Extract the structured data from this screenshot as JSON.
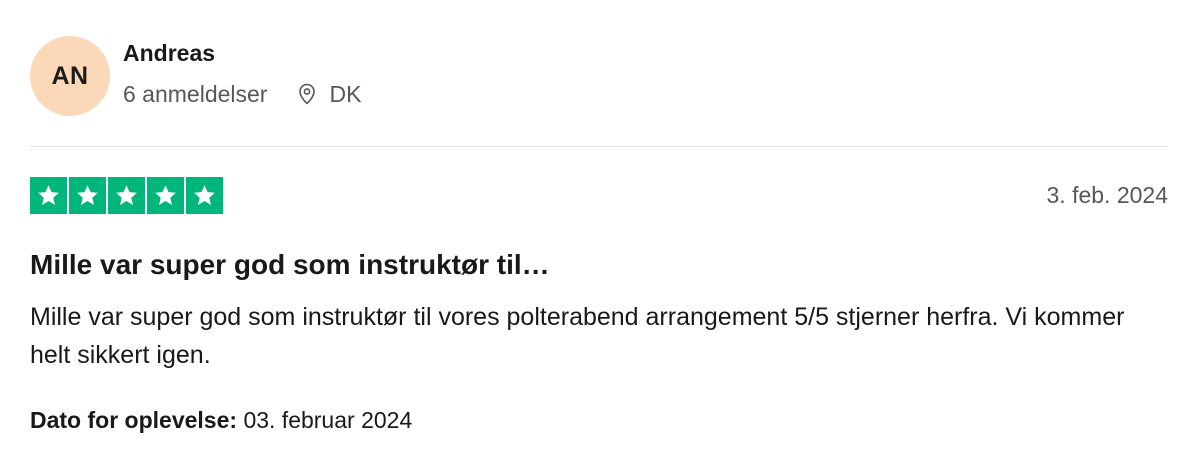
{
  "consumer": {
    "initials": "AN",
    "name": "Andreas",
    "reviews_count": "6 anmeldelser",
    "country": "DK",
    "location_icon": "location-pin-icon",
    "avatar_color": "#fbd9b8"
  },
  "review": {
    "rating": 5,
    "max_rating": 5,
    "star_color": "#00b67a",
    "date": "3. feb. 2024",
    "title": "Mille var super god som instruktør til…",
    "body": "Mille var super god som instruktør til vores polterabend arrangement 5/5 stjerner herfra. Vi kommer helt sikkert igen.",
    "experience_label": "Dato for oplevelse:",
    "experience_date": "03. februar 2024"
  }
}
